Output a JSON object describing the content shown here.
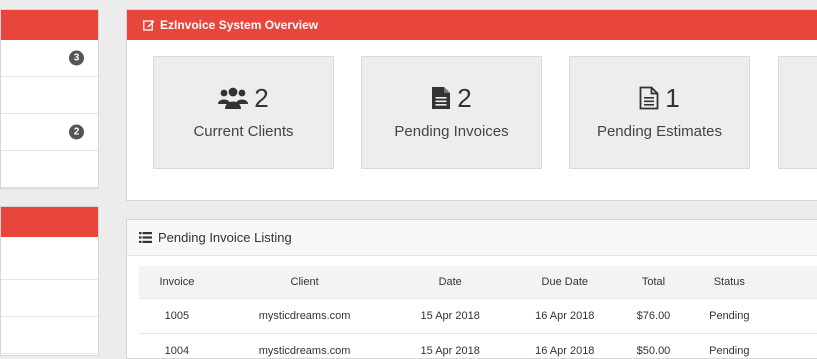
{
  "overview": {
    "title": "EzInvoice System Overview",
    "tiles": [
      {
        "icon": "users-icon",
        "count": "2",
        "label": "Current Clients"
      },
      {
        "icon": "file-text-icon",
        "count": "2",
        "label": "Pending Invoices"
      },
      {
        "icon": "file-outline-icon",
        "count": "1",
        "label": "Pending Estimates"
      }
    ]
  },
  "left_panel": {
    "badges": [
      "3",
      "2"
    ]
  },
  "listing": {
    "title": "Pending Invoice Listing",
    "columns": [
      "Invoice",
      "Client",
      "Date",
      "Due Date",
      "Total",
      "Status"
    ],
    "rows": [
      [
        "1005",
        "mysticdreams.com",
        "15 Apr 2018",
        "16 Apr 2018",
        "$76.00",
        "Pending"
      ],
      [
        "1004",
        "mysticdreams.com",
        "15 Apr 2018",
        "16 Apr 2018",
        "$50.00",
        "Pending"
      ]
    ]
  },
  "colors": {
    "header_red": "#e8463c",
    "tile_bg": "#ededed",
    "page_bg": "#ececec"
  }
}
